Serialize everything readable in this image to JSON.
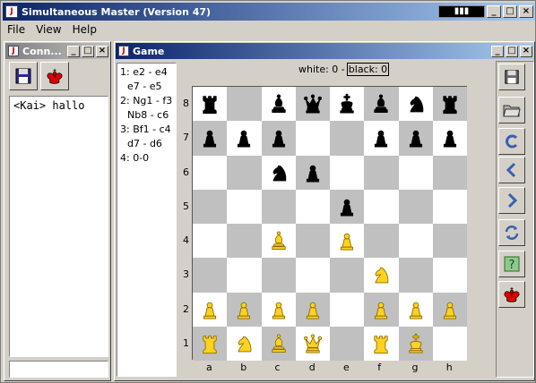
{
  "app": {
    "title": "Simultaneous Master (Version 47)"
  },
  "menubar": [
    "File",
    "View",
    "Help"
  ],
  "connection_window": {
    "title": "Conn...",
    "chat_text": "<Kai> hallo",
    "input_value": ""
  },
  "game_window": {
    "title": "Game",
    "score": {
      "white": "white: 0 -",
      "black": "black: 0"
    }
  },
  "moves": [
    {
      "num": "1:",
      "white": "e2 - e4",
      "black": "e7 - e5"
    },
    {
      "num": "2:",
      "white": "Ng1 - f3",
      "black": "Nb8 - c6"
    },
    {
      "num": "3:",
      "white": "Bf1 - c4",
      "black": "d7 - d6"
    },
    {
      "num": "4:",
      "white": "0-0",
      "black": ""
    }
  ],
  "board": {
    "files": [
      "a",
      "b",
      "c",
      "d",
      "e",
      "f",
      "g",
      "h"
    ],
    "ranks": [
      "8",
      "7",
      "6",
      "5",
      "4",
      "3",
      "2",
      "1"
    ],
    "position": [
      [
        "br",
        "",
        "bb",
        "bq",
        "bk",
        "bb",
        "bn",
        "br"
      ],
      [
        "bp",
        "bp",
        "bp",
        "",
        "",
        "bp",
        "bp",
        "bp"
      ],
      [
        "",
        "",
        "bn",
        "bp",
        "",
        "",
        "",
        ""
      ],
      [
        "",
        "",
        "",
        "",
        "bp",
        "",
        "",
        ""
      ],
      [
        "",
        "",
        "wb",
        "",
        "wp",
        "",
        "",
        ""
      ],
      [
        "",
        "",
        "",
        "",
        "",
        "wn",
        "",
        ""
      ],
      [
        "wp",
        "wp",
        "wp",
        "wp",
        "",
        "wp",
        "wp",
        "wp"
      ],
      [
        "wr",
        "wn",
        "wb",
        "wq",
        "",
        "wr",
        "wk",
        ""
      ]
    ],
    "colors": {
      "light": "#ffffff",
      "dark": "#c0c0c0",
      "white_piece": "#ffd21e",
      "black_piece": "#000000"
    }
  },
  "toolbar_icons": [
    "save-icon",
    "open-folder-icon",
    "undo-icon",
    "back-icon",
    "forward-icon",
    "refresh-icon",
    "help-icon",
    "king-icon"
  ]
}
